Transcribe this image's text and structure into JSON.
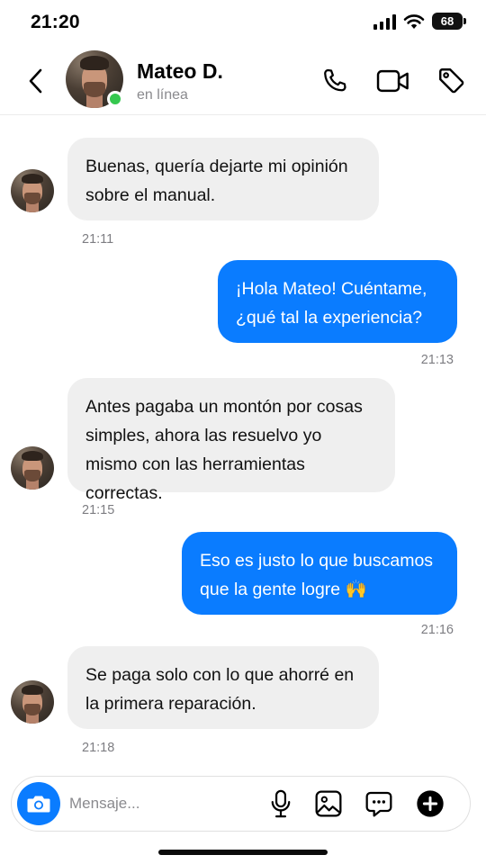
{
  "status_bar": {
    "time": "21:20",
    "battery": "68"
  },
  "header": {
    "contact_name": "Mateo D.",
    "contact_status": "en línea",
    "icons": [
      "back-arrow-icon",
      "phone-icon",
      "video-camera-icon",
      "tag-icon"
    ]
  },
  "messages": [
    {
      "direction": "in",
      "text": "Buenas, quería dejarte mi opinión sobre el manual.",
      "time": "21:11"
    },
    {
      "direction": "out",
      "text": "¡Hola Mateo! Cuéntame, ¿qué tal la experiencia?",
      "time": "21:13"
    },
    {
      "direction": "in",
      "text": "Antes pagaba un montón por cosas simples, ahora las resuelvo yo mismo con las herramientas correctas.",
      "time": "21:15"
    },
    {
      "direction": "out",
      "text": "Eso es justo lo que buscamos que la gente logre 🙌",
      "time": "21:16"
    },
    {
      "direction": "in",
      "text": "Se paga solo con lo que ahorré en la primera reparación.",
      "time": "21:18"
    }
  ],
  "composer": {
    "placeholder": "Mensaje...",
    "icons": [
      "camera-icon",
      "microphone-icon",
      "image-icon",
      "chat-bubble-icon",
      "add-icon"
    ]
  },
  "colors": {
    "accent": "#0a7cff",
    "incoming_bubble": "#efefef",
    "online": "#35c84f"
  }
}
